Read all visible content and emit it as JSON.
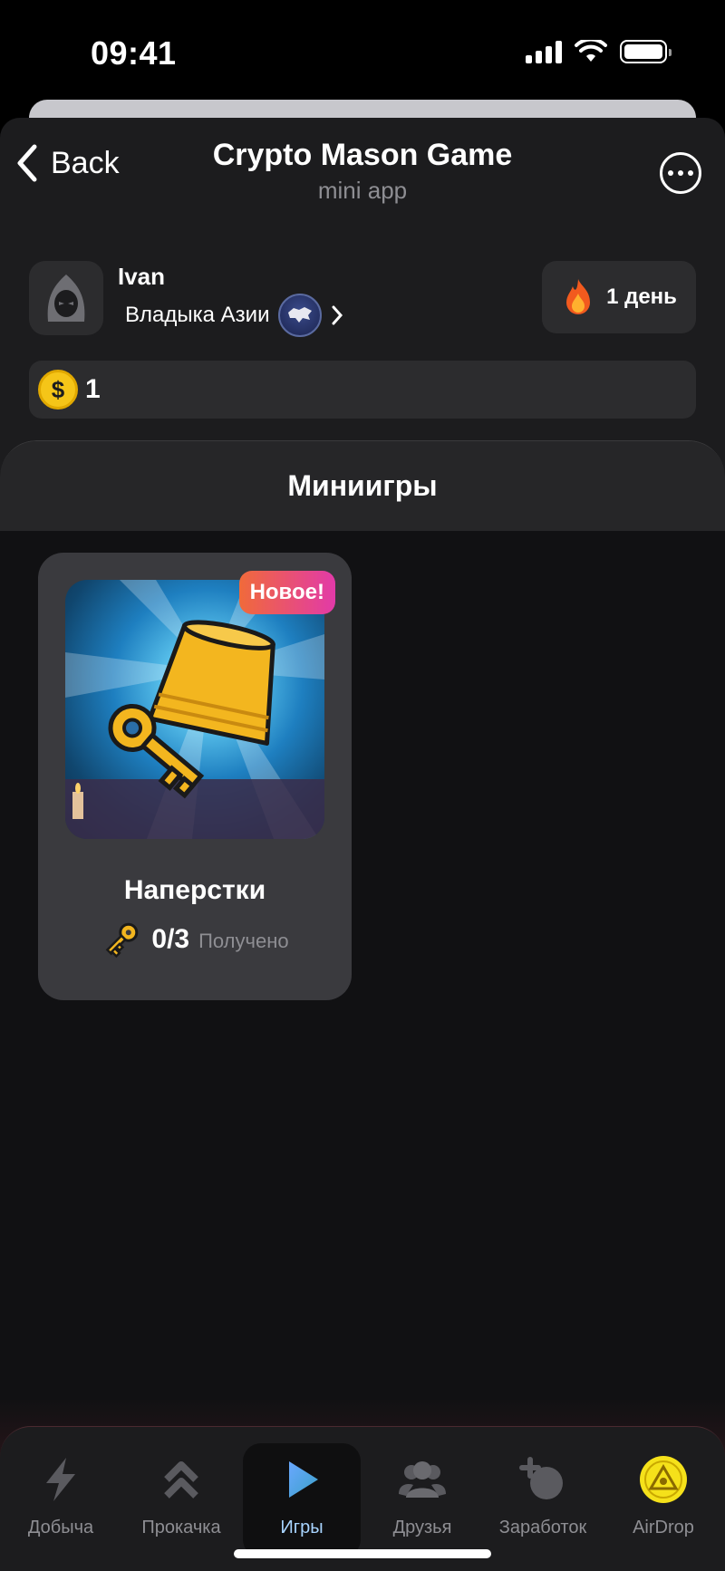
{
  "status_bar": {
    "time": "09:41",
    "icons": [
      "signal-icon",
      "wifi-icon",
      "battery-icon"
    ]
  },
  "header": {
    "back_label": "Back",
    "title": "Crypto Mason Game",
    "subtitle": "mini app",
    "more_icon": "more-icon"
  },
  "profile": {
    "name": "Ivan",
    "rank": "Владыка Азии",
    "streak": "1 день"
  },
  "balance": {
    "coin_symbol": "$",
    "value": "1"
  },
  "section": {
    "title": "Миниигры"
  },
  "game_card": {
    "badge": "Новое!",
    "title": "Наперстки",
    "keys": "0/3",
    "keys_label": "Получено"
  },
  "bottom_nav": {
    "items": [
      {
        "label": "Добыча",
        "icon": "lightning-icon"
      },
      {
        "label": "Прокачка",
        "icon": "double-chevron-up-icon"
      },
      {
        "label": "Игры",
        "icon": "play-icon"
      },
      {
        "label": "Друзья",
        "icon": "friends-icon"
      },
      {
        "label": "Заработок",
        "icon": "coin-plus-icon"
      },
      {
        "label": "AirDrop",
        "icon": "airdrop-icon"
      }
    ],
    "active_index": 2
  },
  "colors": {
    "app_bg": "#1c1c1e",
    "content_bg": "#111113",
    "card_bg": "#3a3a3e",
    "accent_active": "#a8d4ff",
    "coin": "#f5c518",
    "badge_gradient_start": "#f06a3a",
    "badge_gradient_end": "#e23aa8"
  }
}
